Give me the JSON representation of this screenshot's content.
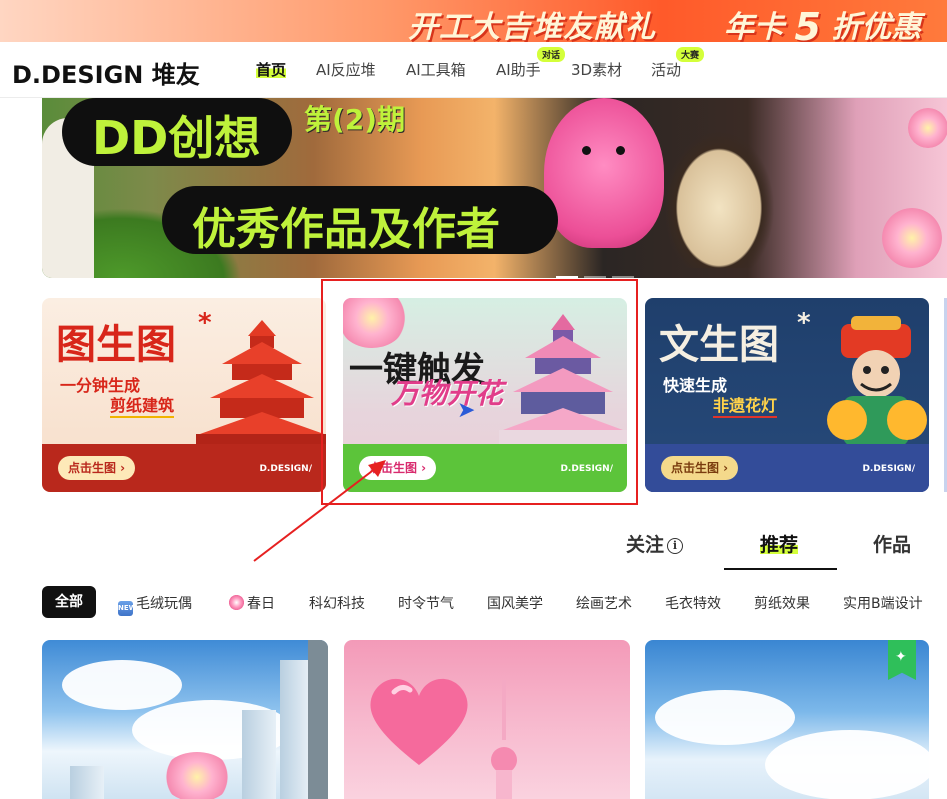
{
  "promo": {
    "text_main": "开工大吉堆友献礼",
    "text_offer_prefix": "年卡",
    "text_offer_number": "5",
    "text_offer_suffix": "折优惠"
  },
  "header": {
    "logo": "D.DESIGN 堆友",
    "nav": [
      {
        "label": "首页",
        "active": true
      },
      {
        "label": "AI反应堆"
      },
      {
        "label": "AI工具箱"
      },
      {
        "label": "AI助手",
        "badge": "对话"
      },
      {
        "label": "3D素材"
      },
      {
        "label": "活动",
        "badge": "大赛"
      }
    ]
  },
  "hero": {
    "title_line1": "DD创想",
    "issue": "第(2)期",
    "title_line2": "优秀作品及作者",
    "slide_count": 3,
    "active_slide": 1
  },
  "cards": [
    {
      "title": "图生图",
      "star": "*",
      "sub1": "一分钟生成",
      "sub2": "剪纸建筑",
      "button": "点击生图 ›",
      "brand": "D.DESIGN/"
    },
    {
      "title": "一键触发",
      "sub": "万物开花",
      "button": "点击生图 ›",
      "brand": "D.DESIGN/"
    },
    {
      "title": "文生图",
      "star": "*",
      "sub1": "快速生成",
      "sub2": "非遗花灯",
      "button": "点击生图 ›",
      "brand": "D.DESIGN/"
    }
  ],
  "tabs": [
    {
      "label": "关注",
      "icon": "info-icon"
    },
    {
      "label": "推荐",
      "active": true
    },
    {
      "label": "作品"
    }
  ],
  "categories": [
    {
      "label": "全部",
      "active": true
    },
    {
      "label": "毛绒玩偶",
      "icon": "new-icon",
      "icon_text": "NEW"
    },
    {
      "label": "春日",
      "icon": "flower-icon"
    },
    {
      "label": "科幻科技"
    },
    {
      "label": "时令节气"
    },
    {
      "label": "国风美学"
    },
    {
      "label": "绘画艺术"
    },
    {
      "label": "毛衣特效"
    },
    {
      "label": "剪纸效果"
    },
    {
      "label": "实用B端设计"
    }
  ],
  "thumbs": [
    {
      "name": "sky-city-flowers"
    },
    {
      "name": "pink-heart-balloon-tower"
    },
    {
      "name": "blue-sky-butterflies",
      "badge_icon": "sparkle-icon"
    }
  ],
  "colors": {
    "accent": "#d4ff3a",
    "hero_text": "#bff23b",
    "annotation": "#e62020"
  }
}
